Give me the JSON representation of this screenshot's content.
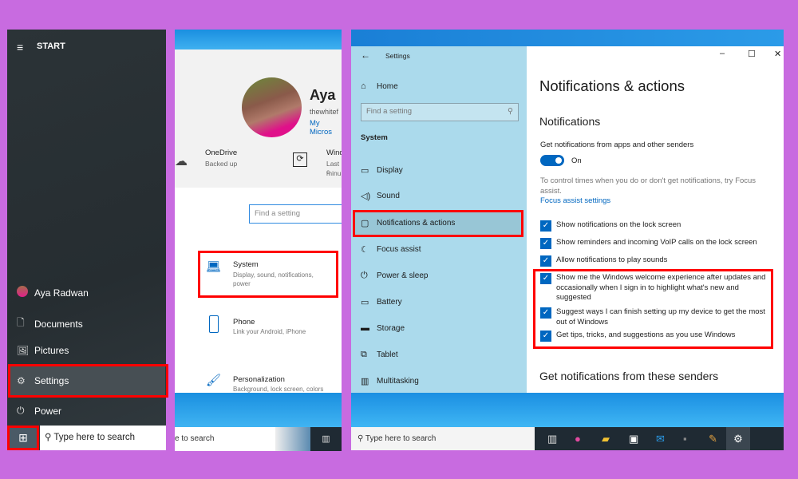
{
  "start_menu": {
    "title": "START",
    "items": [
      {
        "label": "Aya Radwan",
        "icon": "avatar"
      },
      {
        "label": "Documents",
        "icon": "document-icon"
      },
      {
        "label": "Pictures",
        "icon": "pictures-icon"
      },
      {
        "label": "Settings",
        "icon": "gear-icon",
        "highlighted": true
      },
      {
        "label": "Power",
        "icon": "power-icon"
      }
    ],
    "search_placeholder": "Type here to search"
  },
  "settings_home": {
    "user_name": "Aya",
    "user_email": "thewhitef",
    "account_link": "My Micros",
    "onedrive": {
      "title": "OneDrive",
      "status": "Backed up"
    },
    "windows_update": {
      "title": "Wind",
      "line1": "Last c",
      "line2": "minu"
    },
    "search_placeholder": "Find a setting",
    "categories": [
      {
        "title": "System",
        "desc": "Display, sound, notifications, power"
      },
      {
        "title": "Phone",
        "desc": "Link your Android, iPhone"
      },
      {
        "title": "Personalization",
        "desc": "Background, lock screen, colors"
      }
    ],
    "taskbar_search": "e to search"
  },
  "settings_window": {
    "title": "Settings",
    "home": "Home",
    "search_placeholder": "Find a setting",
    "section": "System",
    "nav": [
      {
        "label": "Display",
        "icon": "▭"
      },
      {
        "label": "Sound",
        "icon": "🔈"
      },
      {
        "label": "Notifications & actions",
        "icon": "▢",
        "selected": true
      },
      {
        "label": "Focus assist",
        "icon": "☾"
      },
      {
        "label": "Power & sleep",
        "icon": "⏻"
      },
      {
        "label": "Battery",
        "icon": "▭"
      },
      {
        "label": "Storage",
        "icon": "▬"
      },
      {
        "label": "Tablet",
        "icon": "⧉"
      },
      {
        "label": "Multitasking",
        "icon": "▥"
      }
    ],
    "page_title": "Notifications & actions",
    "subheading": "Notifications",
    "toggle_label": "Get notifications from apps and other senders",
    "toggle_state": "On",
    "toggle_on": true,
    "focus_text": "To control times when you do or don't get notifications, try Focus assist.",
    "focus_link": "Focus assist settings",
    "checkboxes": [
      {
        "label": "Show notifications on the lock screen",
        "checked": true
      },
      {
        "label": "Show reminders and incoming VoIP calls on the lock screen",
        "checked": true
      },
      {
        "label": "Allow notifications to play sounds",
        "checked": true
      },
      {
        "label": "Show me the Windows welcome experience after updates and occasionally when I sign in to highlight what's new and suggested",
        "checked": true
      },
      {
        "label": "Suggest ways I can finish setting up my device to get the most out of Windows",
        "checked": true
      },
      {
        "label": "Get tips, tricks, and suggestions as you use Windows",
        "checked": true
      }
    ],
    "senders_heading": "Get notifications from these senders",
    "taskbar_search": "Type here to search"
  },
  "colors": {
    "background": "#c86be0",
    "accent": "#0067c0",
    "highlight": "#ff0000",
    "sidebar": "#abdaec"
  }
}
